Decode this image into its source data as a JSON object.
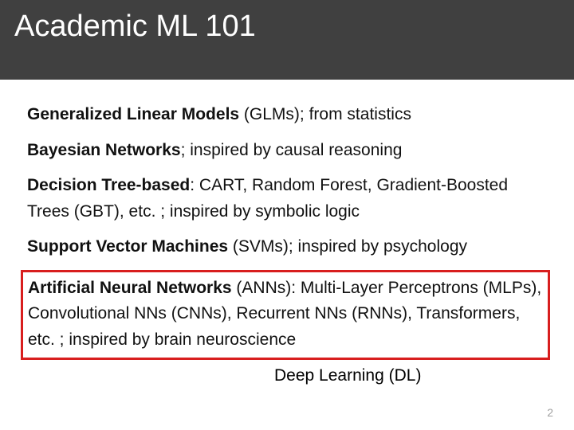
{
  "header": {
    "title": "Academic ML 101"
  },
  "items": {
    "glm": {
      "bold": "Generalized Linear Models",
      "rest": " (GLMs); from statistics"
    },
    "bayes": {
      "bold": "Bayesian Networks",
      "rest": "; inspired by causal reasoning"
    },
    "tree": {
      "bold": "Decision Tree-based",
      "rest": ": CART, Random Forest, Gradient-Boosted Trees (GBT), etc. ; inspired by symbolic logic"
    },
    "svm": {
      "bold": "Support Vector Machines",
      "rest": " (SVMs); inspired by psychology"
    },
    "ann": {
      "bold": "Artificial Neural Networks",
      "rest": " (ANNs): Multi-Layer Perceptrons (MLPs), Convolutional NNs (CNNs), Recurrent NNs (RNNs), Transformers, etc. ; inspired by brain neuroscience"
    }
  },
  "dl_label": "Deep Learning (DL)",
  "page_number": "2"
}
